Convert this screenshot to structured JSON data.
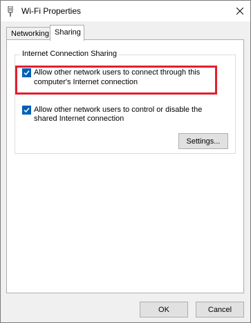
{
  "window": {
    "title": "Wi-Fi Properties",
    "title_icon": "wifi-adapter-icon",
    "close_icon": "close-icon"
  },
  "tabs": [
    {
      "label": "Networking",
      "selected": false
    },
    {
      "label": "Sharing",
      "selected": true
    }
  ],
  "group": {
    "label": "Internet Connection Sharing",
    "options": [
      {
        "line1": "Allow other network users to connect through this",
        "line2": "computer's Internet connection",
        "checked": true
      },
      {
        "line1": "Allow other network users to control or disable the",
        "line2": "shared Internet connection",
        "checked": true
      }
    ],
    "settings_label": "Settings..."
  },
  "footer": {
    "ok_label": "OK",
    "cancel_label": "Cancel"
  },
  "colors": {
    "highlight": "#e31e2d",
    "checkbox": "#005fb8"
  }
}
